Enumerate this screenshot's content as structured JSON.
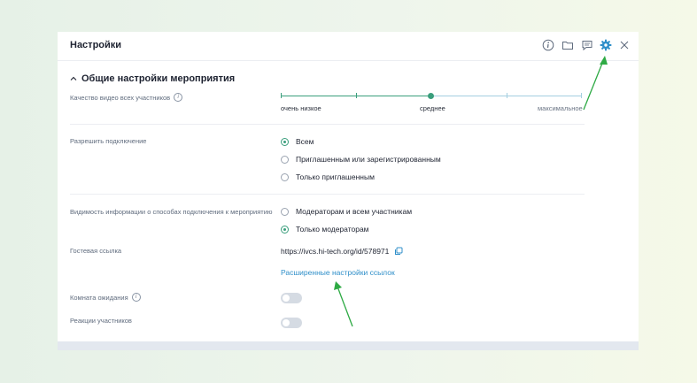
{
  "header": {
    "title": "Настройки",
    "icons": [
      "info-icon",
      "folder-icon",
      "chat-icon",
      "gear-icon",
      "close-icon"
    ],
    "active_color": "#2f8fc9"
  },
  "section": {
    "title": "Общие настройки мероприятия"
  },
  "video_quality": {
    "label": "Качество видео всех участников",
    "options": [
      "очень низкое",
      "среднее",
      "максимальное"
    ],
    "selected": "среднее"
  },
  "allow_connection": {
    "label": "Разрешить подключение",
    "options": [
      {
        "text": "Всем",
        "selected": true
      },
      {
        "text": "Приглашенным или зарегистрированным",
        "selected": false
      },
      {
        "text": "Только приглашенным",
        "selected": false
      }
    ]
  },
  "visibility": {
    "label": "Видимость информации о способах подключения к мероприятию",
    "options": [
      {
        "text": "Модераторам и всем участникам",
        "selected": false
      },
      {
        "text": "Только модераторам",
        "selected": true
      }
    ]
  },
  "guest_link": {
    "label": "Гостевая ссылка",
    "url": "https://ivcs.hi-tech.org/id/578971",
    "advanced": "Расширенные настройки ссылок"
  },
  "waiting_room": {
    "label": "Комната ожидания",
    "enabled": false
  },
  "reactions": {
    "label": "Реакции участников",
    "enabled": false
  },
  "accent_green": "#3a9e7c"
}
